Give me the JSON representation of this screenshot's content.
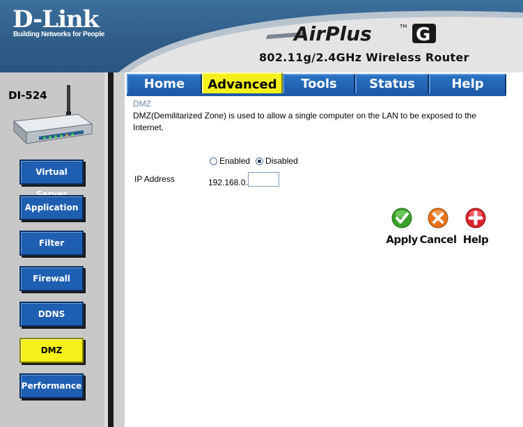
{
  "header": {
    "brand": "D-Link",
    "tagline": "Building Networks for People",
    "product_logo": "AirPlus G",
    "model": "802.11g/2.4GHz Wireless Router"
  },
  "device": {
    "name": "DI-524"
  },
  "tabs": [
    {
      "label": "Home",
      "active": false
    },
    {
      "label": "Advanced",
      "active": true
    },
    {
      "label": "Tools",
      "active": false
    },
    {
      "label": "Status",
      "active": false
    },
    {
      "label": "Help",
      "active": false
    }
  ],
  "sidebar": {
    "items": [
      {
        "label": "Virtual Server",
        "active": false
      },
      {
        "label": "Application",
        "active": false
      },
      {
        "label": "Filter",
        "active": false
      },
      {
        "label": "Firewall",
        "active": false
      },
      {
        "label": "DDNS",
        "active": false
      },
      {
        "label": "DMZ",
        "active": true
      },
      {
        "label": "Performance",
        "active": false
      }
    ]
  },
  "dmz": {
    "title": "DMZ",
    "description": "DMZ(Demilitarized Zone) is used to allow a single computer on the LAN to be exposed to the Internet.",
    "enabled_label": "Enabled",
    "disabled_label": "Disabled",
    "selected": "Disabled",
    "ip_label": "IP Address",
    "ip_prefix": "192.168.0.",
    "ip_value": ""
  },
  "actions": {
    "apply": "Apply",
    "cancel": "Cancel",
    "help": "Help"
  },
  "colors": {
    "header_blue": "#2f5d88",
    "tab_blue": "#1d5aa8",
    "active_yellow": "#f5f01a",
    "apply_green": "#3aa12a",
    "cancel_orange": "#e8731c",
    "help_red": "#d9232b"
  }
}
